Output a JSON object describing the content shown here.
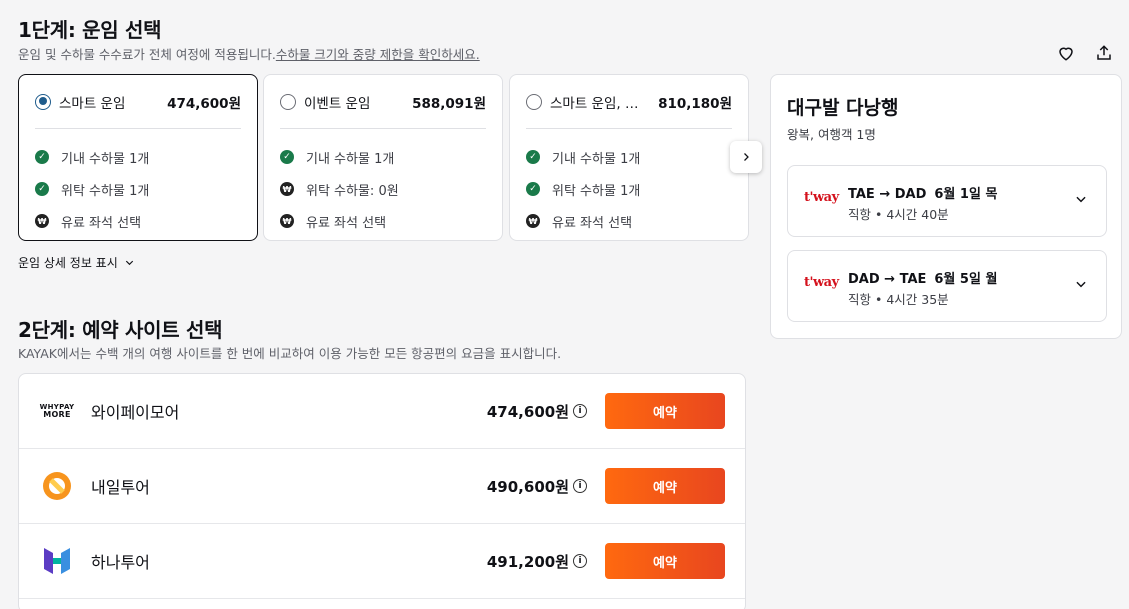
{
  "step1": {
    "title": "1단계: 운임 선택",
    "subtitle": "운임 및 수하물 수수료가 전체 여정에 적용됩니다.",
    "link": "수하물 크기와 중량 제한을 확인하세요."
  },
  "icons": {
    "favorite": "heart-icon",
    "share": "share-icon"
  },
  "fares": [
    {
      "name": "스마트 운임",
      "price": "474,600원",
      "selected": true,
      "features": [
        {
          "icon": "check",
          "text": "기내 수하물 1개"
        },
        {
          "icon": "check",
          "text": "위탁 수하물 1개"
        },
        {
          "icon": "won",
          "text": "유료 좌석 선택"
        }
      ]
    },
    {
      "name": "이벤트 운임",
      "price": "588,091원",
      "selected": false,
      "features": [
        {
          "icon": "check",
          "text": "기내 수하물 1개"
        },
        {
          "icon": "won",
          "text": "위탁 수하물: 0원"
        },
        {
          "icon": "won",
          "text": "유료 좌석 선택"
        }
      ]
    },
    {
      "name": "스마트 운임, 일...",
      "price": "810,180원",
      "selected": false,
      "features": [
        {
          "icon": "check",
          "text": "기내 수하물 1개"
        },
        {
          "icon": "check",
          "text": "위탁 수하물 1개"
        },
        {
          "icon": "won",
          "text": "유료 좌석 선택"
        }
      ]
    }
  ],
  "fare_details_label": "운임 상세 정보 표시",
  "step2": {
    "title": "2단계: 예약 사이트 선택",
    "subtitle": "KAYAK에서는 수백 개의 여행 사이트를 한 번에 비교하여 이용 가능한 모든 항공편의 요금을 표시합니다."
  },
  "providers": [
    {
      "name": "와이페이모어",
      "price": "474,600원",
      "button": "예약",
      "logo_line1": "WHYPAY",
      "logo_line2": "MORE"
    },
    {
      "name": "내일투어",
      "price": "490,600원",
      "button": "예약"
    },
    {
      "name": "하나투어",
      "price": "491,200원",
      "button": "예약"
    }
  ],
  "trip": {
    "title": "대구발 다낭행",
    "subtitle": "왕복, 여행객 1명",
    "airline_logo": "t'way",
    "legs": [
      {
        "route": "TAE → DAD",
        "date": "6월 1일 목",
        "detail": "직항 • 4시간 40분"
      },
      {
        "route": "DAD → TAE",
        "date": "6월 5일 월",
        "detail": "직항 • 4시간 35분"
      }
    ]
  },
  "colors": {
    "accent": "#ff690f",
    "check": "#1a7a4a",
    "radio": "#1f5c8c",
    "tway": "#d4111c"
  }
}
